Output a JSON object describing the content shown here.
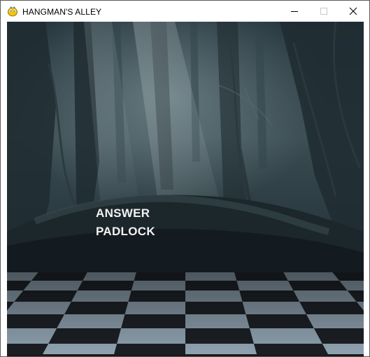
{
  "window": {
    "title": "HANGMAN'S ALLEY",
    "icon": "pygame-snake-icon",
    "controls": {
      "minimize": "minimize-icon",
      "maximize": "maximize-icon",
      "close": "close-icon"
    }
  },
  "game": {
    "answer_label": "ANSWER",
    "answer_word": "PADLOCK",
    "background": "dark-forest-with-checkered-floor"
  },
  "colors": {
    "text": "#f2f2f2",
    "forest_dark": "#1e2a30",
    "floor_light": "#8fa2b0",
    "floor_dark": "#1b1f24"
  }
}
